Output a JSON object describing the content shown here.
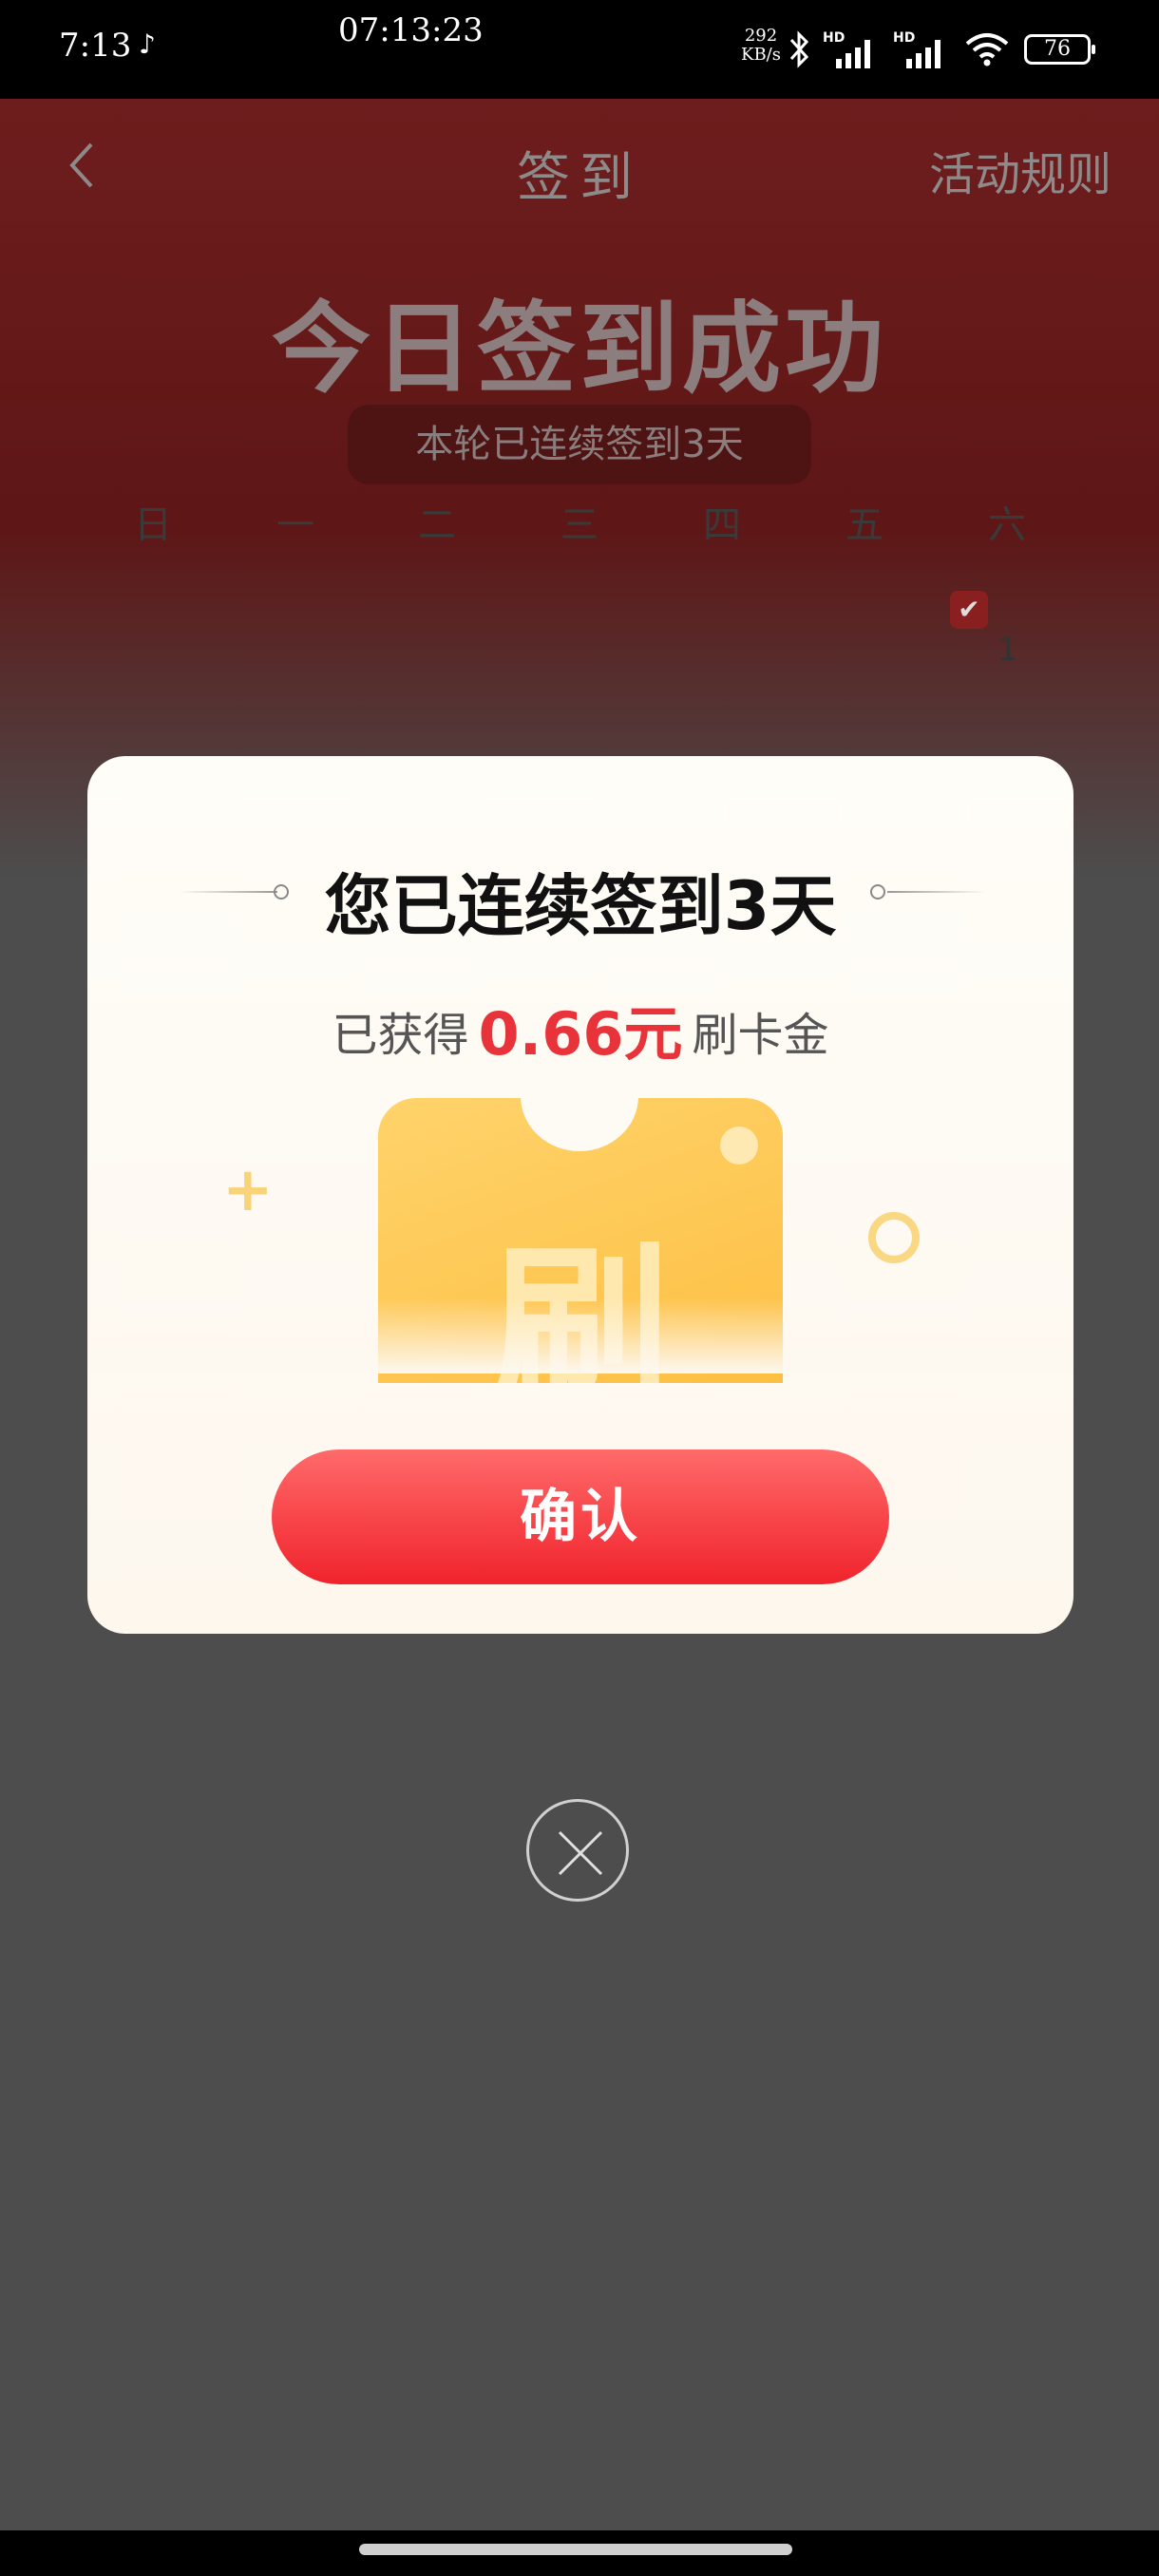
{
  "status_bar": {
    "time": "7:13",
    "clock": "07:13:23",
    "net_speed_value": "292",
    "net_speed_unit": "KB/s",
    "battery": "76",
    "app_icon": "tiktok-icon",
    "icons": [
      "bluetooth-icon",
      "hd-signal-icon",
      "hd-signal-icon",
      "wifi-icon",
      "battery-icon"
    ]
  },
  "header": {
    "title": "签到",
    "rules_link": "活动规则",
    "back_icon": "chevron-left-icon"
  },
  "hero": {
    "title": "今日签到成功",
    "streak_pill": "本轮已连续签到3天"
  },
  "calendar": {
    "weekdays": [
      "日",
      "一",
      "二",
      "三",
      "四",
      "五",
      "六"
    ],
    "checked_day": "1"
  },
  "modal": {
    "title": "您已连续签到3天",
    "reward_prefix": "已获得",
    "reward_amount": "0.66元",
    "reward_suffix": "刷卡金",
    "card_char": "刷",
    "confirm_label": "确认",
    "close_icon": "close-circle-icon"
  },
  "colors": {
    "accent_red": "#e8333a",
    "button_red": "#f0232c",
    "card_gold": "#fdbf42"
  }
}
